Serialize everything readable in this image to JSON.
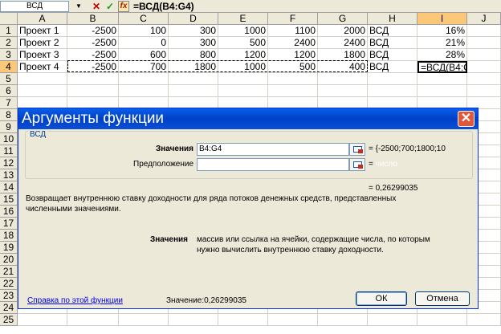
{
  "formula_bar": {
    "name_box": "ВСД",
    "dropdown_glyph": "▼",
    "cancel_glyph": "✕",
    "enter_glyph": "✓",
    "fx_glyph": "fx",
    "formula": "=ВСД(B4:G4)"
  },
  "columns": [
    "A",
    "B",
    "C",
    "D",
    "E",
    "F",
    "G",
    "H",
    "I",
    "J"
  ],
  "rows": [
    "1",
    "2",
    "3",
    "4",
    "5",
    "6",
    "7",
    "8",
    "9",
    "10",
    "11",
    "12",
    "13",
    "14",
    "15",
    "16",
    "17",
    "18",
    "19",
    "20",
    "21",
    "22",
    "23",
    "24",
    "25"
  ],
  "sheet": {
    "r1": [
      "Проект 1",
      "-2500",
      "100",
      "300",
      "1000",
      "1100",
      "2000",
      "ВСД",
      "16%",
      ""
    ],
    "r2": [
      "Проект 2",
      "-2500",
      "0",
      "300",
      "500",
      "2400",
      "2400",
      "ВСД",
      "21%",
      ""
    ],
    "r3": [
      "Проект 3",
      "-2500",
      "600",
      "800",
      "1200",
      "1200",
      "1800",
      "ВСД",
      "28%",
      ""
    ],
    "r4": [
      "Проект 4",
      "-2500",
      "700",
      "1800",
      "1000",
      "500",
      "400",
      "ВСД",
      "=ВСД(B4:G4)",
      ""
    ]
  },
  "dialog": {
    "title": "Аргументы функции",
    "close_glyph": "✕",
    "group_label": "ВСД",
    "arg1_label": "Значения",
    "arg1_value": "B4:G4",
    "arg1_result": "= {-2500;700;1800;10",
    "arg2_label": "Предположение",
    "arg2_value": "",
    "arg2_result_eq": "=",
    "arg2_hint": "число",
    "result": "= 0,26299035",
    "description": "Возвращает внутреннюю ставку доходности для ряда потоков денежных средств, представленных численными значениями.",
    "param_name": "Значения",
    "param_desc": "массив или ссылка на ячейки, содержащие числа, по которым нужно вычислить внутреннюю ставку доходности.",
    "help_link": "Справка по этой функции",
    "value_label": "Значение:",
    "value": "0,26299035",
    "ok_label": "ОК",
    "cancel_label": "Отмена"
  },
  "colors": {
    "title_bar": "#0a4fd5",
    "selected_header": "#fbc87a",
    "close_button": "#e2573c",
    "link": "#0000ee"
  }
}
